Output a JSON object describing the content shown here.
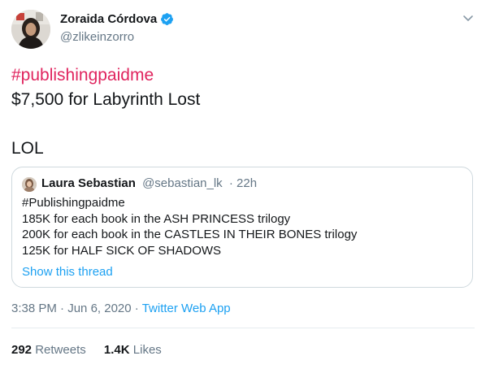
{
  "tweet": {
    "author": {
      "name": "Zoraida Córdova",
      "handle": "@zlikeinzorro",
      "verified": true
    },
    "text": {
      "hashtag": "#publishingpaidme",
      "line2": "$7,500 for Labyrinth Lost",
      "line3": "LOL"
    },
    "quote": {
      "author_name": "Laura Sebastian",
      "author_handle": "@sebastian_lk",
      "time": "· 22h",
      "lines": [
        "#Publishingpaidme",
        "185K for each book in the ASH PRINCESS trilogy",
        "200K for each book in the CASTLES IN THEIR BONES trilogy",
        "125K for HALF SICK OF SHADOWS"
      ],
      "show_thread": "Show this thread"
    },
    "meta": {
      "time": "3:38 PM",
      "sep1": "·",
      "date": "Jun 6, 2020",
      "sep2": "·",
      "source": "Twitter Web App"
    },
    "stats": {
      "retweets_count": "292",
      "retweets_label": "Retweets",
      "likes_count": "1.4K",
      "likes_label": "Likes"
    }
  },
  "colors": {
    "hashtag": "#e0245e",
    "link": "#1da1f2",
    "verified": "#1da1f2",
    "secondary_text": "#657786"
  },
  "icons": {
    "verified": "verified-badge-icon",
    "caret": "chevron-down-icon"
  }
}
